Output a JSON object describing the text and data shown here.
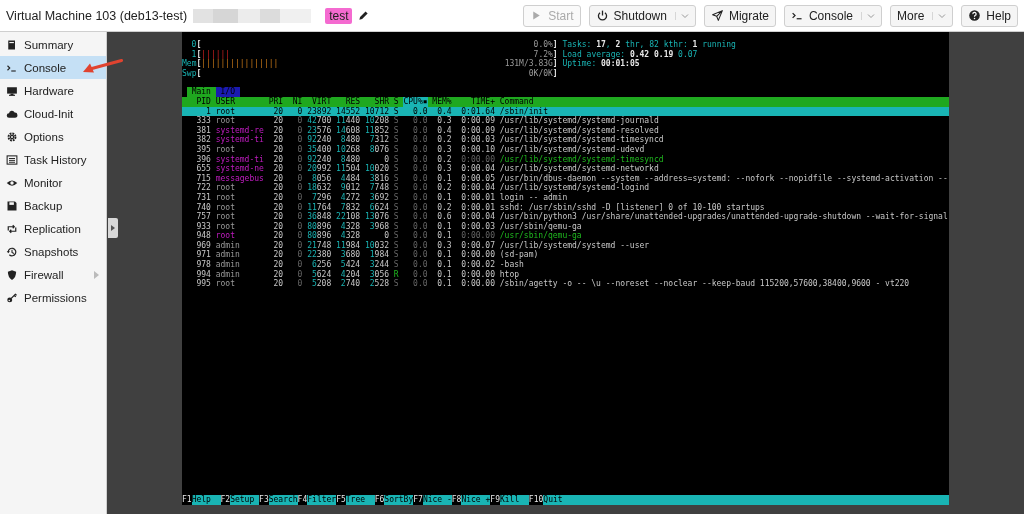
{
  "header": {
    "title": "Virtual Machine 103 (deb13-test)",
    "tag": "test",
    "buttons": [
      {
        "label": "Start",
        "disabled": true,
        "split": false
      },
      {
        "label": "Shutdown",
        "disabled": false,
        "split": true
      },
      {
        "label": "Migrate",
        "disabled": false,
        "split": false
      },
      {
        "label": "Console",
        "disabled": false,
        "split": true
      },
      {
        "label": "More",
        "disabled": false,
        "split": true
      },
      {
        "label": "Help",
        "disabled": false,
        "split": false
      }
    ]
  },
  "sidebar": {
    "items": [
      {
        "label": "Summary",
        "selected": false,
        "expandable": false
      },
      {
        "label": "Console",
        "selected": true,
        "expandable": false
      },
      {
        "label": "Hardware",
        "selected": false,
        "expandable": false
      },
      {
        "label": "Cloud-Init",
        "selected": false,
        "expandable": false
      },
      {
        "label": "Options",
        "selected": false,
        "expandable": false
      },
      {
        "label": "Task History",
        "selected": false,
        "expandable": false
      },
      {
        "label": "Monitor",
        "selected": false,
        "expandable": false
      },
      {
        "label": "Backup",
        "selected": false,
        "expandable": false
      },
      {
        "label": "Replication",
        "selected": false,
        "expandable": false
      },
      {
        "label": "Snapshots",
        "selected": false,
        "expandable": false
      },
      {
        "label": "Firewall",
        "selected": false,
        "expandable": true
      },
      {
        "label": "Permissions",
        "selected": false,
        "expandable": false
      }
    ]
  },
  "terminal": {
    "meters": [
      {
        "label": "0",
        "open": "[",
        "value": "0.0%",
        "close": "]"
      },
      {
        "label": "1",
        "open": "[",
        "bar": "||||||",
        "value": "7.2%",
        "close": "]"
      },
      {
        "label": "Mem",
        "open": "[",
        "bar": "||||||||||||||||",
        "value": "131M/3.83G",
        "close": "]"
      },
      {
        "label": "Swp",
        "open": "[",
        "value": "0K/0K",
        "close": "]"
      }
    ],
    "info": [
      "Tasks: **17**, **2** thr, 82 kthr: **1** running",
      "Load average: **0.42 0.19** 0.07",
      "Uptime: **00:01:05**"
    ],
    "tabs": [
      {
        "label": "Main",
        "selected": true
      },
      {
        "label": "I/O",
        "selected": false
      }
    ],
    "columns": [
      {
        "label": "PID",
        "sorted": false
      },
      {
        "label": "USER",
        "sorted": false
      },
      {
        "label": "PRI",
        "sorted": false
      },
      {
        "label": "NI",
        "sorted": false
      },
      {
        "label": "VIRT",
        "sorted": false
      },
      {
        "label": "RES",
        "sorted": false
      },
      {
        "label": "SHR",
        "sorted": false
      },
      {
        "label": "S",
        "sorted": false
      },
      {
        "label": "CPU%▪",
        "sorted": true
      },
      {
        "label": "MEM%",
        "sorted": false
      },
      {
        "label": "TIME+",
        "sorted": false
      },
      {
        "label": "Command",
        "sorted": false
      }
    ],
    "rows": [
      {
        "pid": "1",
        "user": "root",
        "pri": "20",
        "ni": "0",
        "virt": "23892",
        "res": "14552",
        "shr": "10712",
        "s": "S",
        "cpu": "0.0",
        "mem": "0.4",
        "time": "0:01.64",
        "command": "/sbin/init",
        "selected": true,
        "system_user": false,
        "thread": false
      },
      {
        "pid": "333",
        "user": "root",
        "pri": "20",
        "ni": "0",
        "virt": "42700",
        "res": "11440",
        "shr": "10208",
        "s": "S",
        "cpu": "0.0",
        "mem": "0.3",
        "time": "0:00.09",
        "command": "/usr/lib/systemd/systemd-journald",
        "selected": false,
        "system_user": false,
        "thread": false
      },
      {
        "pid": "381",
        "user": "systemd-re",
        "pri": "20",
        "ni": "0",
        "virt": "23576",
        "res": "14608",
        "shr": "11852",
        "s": "S",
        "cpu": "0.0",
        "mem": "0.4",
        "time": "0:00.09",
        "command": "/usr/lib/systemd/systemd-resolved",
        "selected": false,
        "system_user": true,
        "thread": false
      },
      {
        "pid": "382",
        "user": "systemd-ti",
        "pri": "20",
        "ni": "0",
        "virt": "92240",
        "res": "8480",
        "shr": "7312",
        "s": "S",
        "cpu": "0.0",
        "mem": "0.2",
        "time": "0:00.03",
        "command": "/usr/lib/systemd/systemd-timesyncd",
        "selected": false,
        "system_user": true,
        "thread": false
      },
      {
        "pid": "395",
        "user": "root",
        "pri": "20",
        "ni": "0",
        "virt": "35400",
        "res": "10268",
        "shr": "8076",
        "s": "S",
        "cpu": "0.0",
        "mem": "0.3",
        "time": "0:00.10",
        "command": "/usr/lib/systemd/systemd-udevd",
        "selected": false,
        "system_user": false,
        "thread": false
      },
      {
        "pid": "396",
        "user": "systemd-ti",
        "pri": "20",
        "ni": "0",
        "virt": "92240",
        "res": "8480",
        "shr": "0",
        "s": "S",
        "cpu": "0.0",
        "mem": "0.2",
        "time": "0:00.00",
        "command": "/usr/lib/systemd/systemd-timesyncd",
        "selected": false,
        "system_user": true,
        "thread": true
      },
      {
        "pid": "655",
        "user": "systemd-ne",
        "pri": "20",
        "ni": "0",
        "virt": "20992",
        "res": "11504",
        "shr": "10020",
        "s": "S",
        "cpu": "0.0",
        "mem": "0.3",
        "time": "0:00.04",
        "command": "/usr/lib/systemd/systemd-networkd",
        "selected": false,
        "system_user": true,
        "thread": false
      },
      {
        "pid": "715",
        "user": "messagebus",
        "pri": "20",
        "ni": "0",
        "virt": "8056",
        "res": "4484",
        "shr": "3816",
        "s": "S",
        "cpu": "0.0",
        "mem": "0.1",
        "time": "0:00.05",
        "command": "/usr/bin/dbus-daemon --system --address=systemd: --nofork --nopidfile --systemd-activation --",
        "selected": false,
        "system_user": true,
        "thread": false
      },
      {
        "pid": "722",
        "user": "root",
        "pri": "20",
        "ni": "0",
        "virt": "18632",
        "res": "9012",
        "shr": "7748",
        "s": "S",
        "cpu": "0.0",
        "mem": "0.2",
        "time": "0:00.04",
        "command": "/usr/lib/systemd/systemd-logind",
        "selected": false,
        "system_user": false,
        "thread": false
      },
      {
        "pid": "731",
        "user": "root",
        "pri": "20",
        "ni": "0",
        "virt": "7296",
        "res": "4272",
        "shr": "3692",
        "s": "S",
        "cpu": "0.0",
        "mem": "0.1",
        "time": "0:00.01",
        "command": "login -- admin",
        "selected": false,
        "system_user": false,
        "thread": false
      },
      {
        "pid": "740",
        "user": "root",
        "pri": "20",
        "ni": "0",
        "virt": "11764",
        "res": "7832",
        "shr": "6624",
        "s": "S",
        "cpu": "0.0",
        "mem": "0.2",
        "time": "0:00.01",
        "command": "sshd: /usr/sbin/sshd -D [listener] 0 of 10-100 startups",
        "selected": false,
        "system_user": false,
        "thread": false
      },
      {
        "pid": "757",
        "user": "root",
        "pri": "20",
        "ni": "0",
        "virt": "36848",
        "res": "22108",
        "shr": "13076",
        "s": "S",
        "cpu": "0.0",
        "mem": "0.6",
        "time": "0:00.04",
        "command": "/usr/bin/python3 /usr/share/unattended-upgrades/unattended-upgrade-shutdown --wait-for-signal",
        "selected": false,
        "system_user": false,
        "thread": false
      },
      {
        "pid": "933",
        "user": "root",
        "pri": "20",
        "ni": "0",
        "virt": "80896",
        "res": "4328",
        "shr": "3968",
        "s": "S",
        "cpu": "0.0",
        "mem": "0.1",
        "time": "0:00.03",
        "command": "/usr/sbin/qemu-ga",
        "selected": false,
        "system_user": false,
        "thread": false
      },
      {
        "pid": "948",
        "user": "root",
        "pri": "20",
        "ni": "0",
        "virt": "80896",
        "res": "4328",
        "shr": "0",
        "s": "S",
        "cpu": "0.0",
        "mem": "0.1",
        "time": "0:00.00",
        "command": "/usr/sbin/qemu-ga",
        "selected": false,
        "system_user": true,
        "thread": true
      },
      {
        "pid": "969",
        "user": "admin",
        "pri": "20",
        "ni": "0",
        "virt": "21748",
        "res": "11984",
        "shr": "10032",
        "s": "S",
        "cpu": "0.0",
        "mem": "0.3",
        "time": "0:00.07",
        "command": "/usr/lib/systemd/systemd --user",
        "selected": false,
        "system_user": false,
        "thread": false
      },
      {
        "pid": "971",
        "user": "admin",
        "pri": "20",
        "ni": "0",
        "virt": "22380",
        "res": "3680",
        "shr": "1984",
        "s": "S",
        "cpu": "0.0",
        "mem": "0.1",
        "time": "0:00.00",
        "command": "(sd-pam)",
        "selected": false,
        "system_user": false,
        "thread": false
      },
      {
        "pid": "978",
        "user": "admin",
        "pri": "20",
        "ni": "0",
        "virt": "6256",
        "res": "5424",
        "shr": "3244",
        "s": "S",
        "cpu": "0.0",
        "mem": "0.1",
        "time": "0:00.02",
        "command": "-bash",
        "selected": false,
        "system_user": false,
        "thread": false
      },
      {
        "pid": "994",
        "user": "admin",
        "pri": "20",
        "ni": "0",
        "virt": "5624",
        "res": "4204",
        "shr": "3056",
        "s": "R",
        "cpu": "0.0",
        "mem": "0.1",
        "time": "0:00.00",
        "command": "htop",
        "selected": false,
        "system_user": false,
        "thread": false
      },
      {
        "pid": "995",
        "user": "root",
        "pri": "20",
        "ni": "0",
        "virt": "5208",
        "res": "2740",
        "shr": "2528",
        "s": "S",
        "cpu": "0.0",
        "mem": "0.1",
        "time": "0:00.00",
        "command": "/sbin/agetty -o -- \\u --noreset --noclear --keep-baud 115200,57600,38400,9600 - vt220",
        "selected": false,
        "system_user": false,
        "thread": false
      }
    ],
    "function_keys": [
      {
        "key": "F1",
        "label": "Help"
      },
      {
        "key": "F2",
        "label": "Setup"
      },
      {
        "key": "F3",
        "label": "Search"
      },
      {
        "key": "F4",
        "label": "Filter"
      },
      {
        "key": "F5",
        "label": "Tree"
      },
      {
        "key": "F6",
        "label": "SortBy"
      },
      {
        "key": "F7",
        "label": "Nice -"
      },
      {
        "key": "F8",
        "label": "Nice +"
      },
      {
        "key": "F9",
        "label": "Kill"
      },
      {
        "key": "F10",
        "label": "Quit"
      }
    ]
  }
}
